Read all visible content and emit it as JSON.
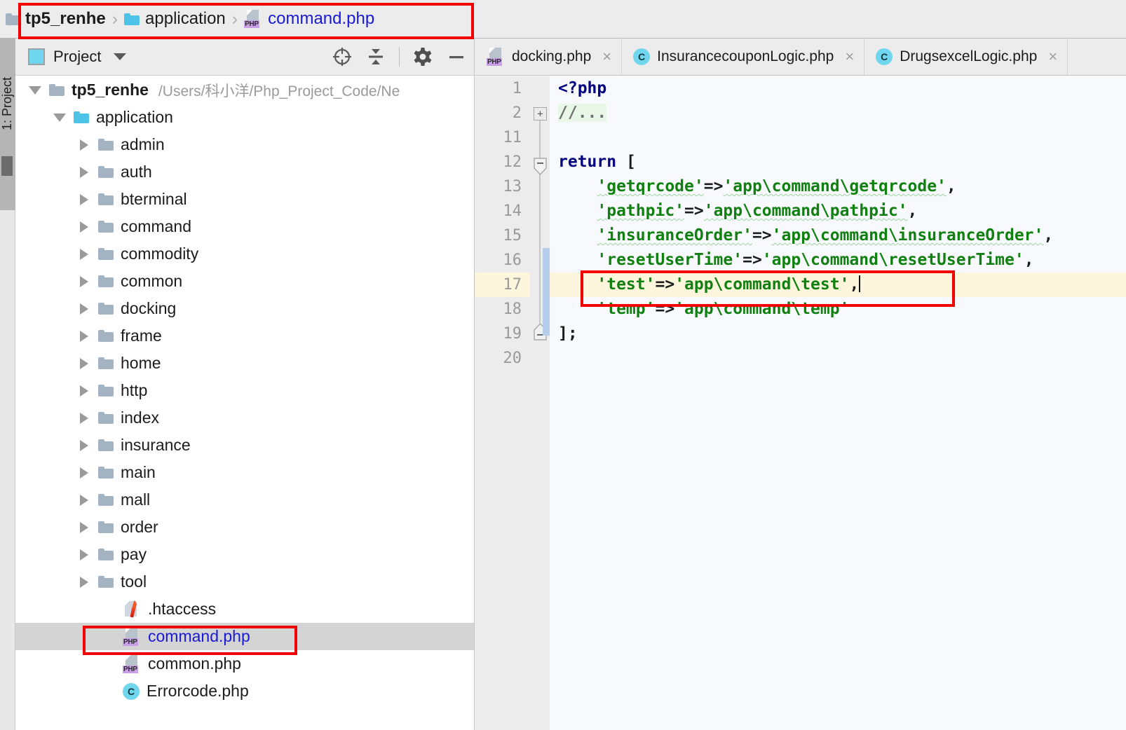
{
  "breadcrumb": {
    "items": [
      {
        "label": "tp5_renhe",
        "icon": "folder-icon",
        "style": "bold"
      },
      {
        "label": "application",
        "icon": "folder-icon-cyan",
        "style": "normal"
      },
      {
        "label": "command.php",
        "icon": "php-file-icon",
        "style": "link"
      }
    ],
    "separator": "›"
  },
  "toolstrip": {
    "label": "1: Project"
  },
  "project_panel": {
    "title": "Project",
    "caret": "▼",
    "actions": [
      {
        "name": "locate-icon",
        "tooltip": "Select Opened File"
      },
      {
        "name": "collapse-all-icon",
        "tooltip": "Collapse All"
      },
      {
        "name": "gear-icon",
        "tooltip": "Settings"
      },
      {
        "name": "minimize-icon",
        "tooltip": "Hide"
      }
    ],
    "tree": [
      {
        "label": "tp5_renhe",
        "path": "/Users/科小洋/Php_Project_Code/Ne",
        "icon": "folder-icon",
        "expanded": true,
        "indent": 0,
        "bold": true
      },
      {
        "label": "application",
        "icon": "folder-icon-cyan",
        "expanded": true,
        "indent": 1
      },
      {
        "label": "admin",
        "icon": "folder-icon",
        "expanded": false,
        "indent": 2
      },
      {
        "label": "auth",
        "icon": "folder-icon",
        "expanded": false,
        "indent": 2
      },
      {
        "label": "bterminal",
        "icon": "folder-icon",
        "expanded": false,
        "indent": 2
      },
      {
        "label": "command",
        "icon": "folder-icon",
        "expanded": false,
        "indent": 2
      },
      {
        "label": "commodity",
        "icon": "folder-icon",
        "expanded": false,
        "indent": 2
      },
      {
        "label": "common",
        "icon": "folder-icon",
        "expanded": false,
        "indent": 2
      },
      {
        "label": "docking",
        "icon": "folder-icon",
        "expanded": false,
        "indent": 2
      },
      {
        "label": "frame",
        "icon": "folder-icon",
        "expanded": false,
        "indent": 2
      },
      {
        "label": "home",
        "icon": "folder-icon",
        "expanded": false,
        "indent": 2
      },
      {
        "label": "http",
        "icon": "folder-icon",
        "expanded": false,
        "indent": 2
      },
      {
        "label": "index",
        "icon": "folder-icon",
        "expanded": false,
        "indent": 2
      },
      {
        "label": "insurance",
        "icon": "folder-icon",
        "expanded": false,
        "indent": 2
      },
      {
        "label": "main",
        "icon": "folder-icon",
        "expanded": false,
        "indent": 2
      },
      {
        "label": "mall",
        "icon": "folder-icon",
        "expanded": false,
        "indent": 2
      },
      {
        "label": "order",
        "icon": "folder-icon",
        "expanded": false,
        "indent": 2
      },
      {
        "label": "pay",
        "icon": "folder-icon",
        "expanded": false,
        "indent": 2
      },
      {
        "label": "tool",
        "icon": "folder-icon",
        "expanded": false,
        "indent": 2
      },
      {
        "label": ".htaccess",
        "icon": "htaccess-file-icon",
        "indent": 3
      },
      {
        "label": "command.php",
        "icon": "php-file-icon",
        "indent": 3,
        "selected": true,
        "link": true
      },
      {
        "label": "common.php",
        "icon": "php-file-icon",
        "indent": 3
      },
      {
        "label": "Errorcode.php",
        "icon": "class-file-icon",
        "indent": 3
      }
    ]
  },
  "editor": {
    "tabs": [
      {
        "label": "docking.php",
        "icon": "php-file-icon",
        "close": "×",
        "active": false
      },
      {
        "label": "InsurancecouponLogic.php",
        "icon": "class-file-icon",
        "close": "×",
        "active": false
      },
      {
        "label": "DrugsexcelLogic.php",
        "icon": "class-file-icon",
        "close": "×",
        "active": false
      }
    ],
    "line_numbers": [
      "1",
      "2",
      "11",
      "12",
      "13",
      "14",
      "15",
      "16",
      "17",
      "18",
      "19",
      "20"
    ],
    "current_line": "17",
    "code_lines": [
      {
        "num": "1",
        "segments": [
          {
            "t": "<?php",
            "c": "kw"
          }
        ]
      },
      {
        "num": "2",
        "segments": [
          {
            "t": "//...",
            "c": "cmt"
          }
        ],
        "folded": true
      },
      {
        "num": "11",
        "segments": []
      },
      {
        "num": "12",
        "segments": [
          {
            "t": "return",
            "c": "kw"
          },
          {
            "t": " [",
            "c": "op"
          }
        ]
      },
      {
        "num": "13",
        "segments": [
          {
            "t": "    ",
            "c": "op"
          },
          {
            "t": "'getqrcode'",
            "c": "str squig"
          },
          {
            "t": "=>",
            "c": "op"
          },
          {
            "t": "'app\\command\\getqrcode'",
            "c": "str squig"
          },
          {
            "t": ",",
            "c": "op"
          }
        ]
      },
      {
        "num": "14",
        "segments": [
          {
            "t": "    ",
            "c": "op"
          },
          {
            "t": "'pathpic'",
            "c": "str squig"
          },
          {
            "t": "=>",
            "c": "op"
          },
          {
            "t": "'app\\command\\pathpic'",
            "c": "str squig"
          },
          {
            "t": ",",
            "c": "op"
          }
        ]
      },
      {
        "num": "15",
        "segments": [
          {
            "t": "    ",
            "c": "op"
          },
          {
            "t": "'insuranceOrder'",
            "c": "str squig"
          },
          {
            "t": "=>",
            "c": "op"
          },
          {
            "t": "'app\\command\\insuranceOrder'",
            "c": "str squig"
          },
          {
            "t": ",",
            "c": "op"
          }
        ]
      },
      {
        "num": "16",
        "segments": [
          {
            "t": "    ",
            "c": "op"
          },
          {
            "t": "'resetUserTime'",
            "c": "str"
          },
          {
            "t": "=>",
            "c": "op"
          },
          {
            "t": "'app\\command\\resetUserTime'",
            "c": "str"
          },
          {
            "t": ",",
            "c": "op"
          }
        ]
      },
      {
        "num": "17",
        "segments": [
          {
            "t": "    ",
            "c": "op"
          },
          {
            "t": "'test'",
            "c": "str"
          },
          {
            "t": "=>",
            "c": "op"
          },
          {
            "t": "'app\\command\\test'",
            "c": "str"
          },
          {
            "t": ",",
            "c": "op"
          }
        ],
        "current": true,
        "caret": true
      },
      {
        "num": "18",
        "segments": [
          {
            "t": "    ",
            "c": "op"
          },
          {
            "t": "'temp'",
            "c": "str"
          },
          {
            "t": "=>",
            "c": "op"
          },
          {
            "t": "'app\\command\\temp'",
            "c": "str"
          }
        ]
      },
      {
        "num": "19",
        "segments": [
          {
            "t": "];",
            "c": "op"
          }
        ]
      },
      {
        "num": "20",
        "segments": []
      }
    ]
  },
  "annotations": {
    "color": "#f00000",
    "boxes": [
      {
        "name": "breadcrumb-highlight"
      },
      {
        "name": "code-line-17-highlight"
      },
      {
        "name": "tree-command-php-highlight"
      }
    ]
  },
  "colors": {
    "accent_blue": "#1a1ad4",
    "string_green": "#108010",
    "keyword_navy": "#000080",
    "current_line": "#fdf6dd",
    "selection_grey": "#d4d4d4",
    "annotation_red": "#f00000",
    "folder_cyan": "#4ec3e8"
  }
}
